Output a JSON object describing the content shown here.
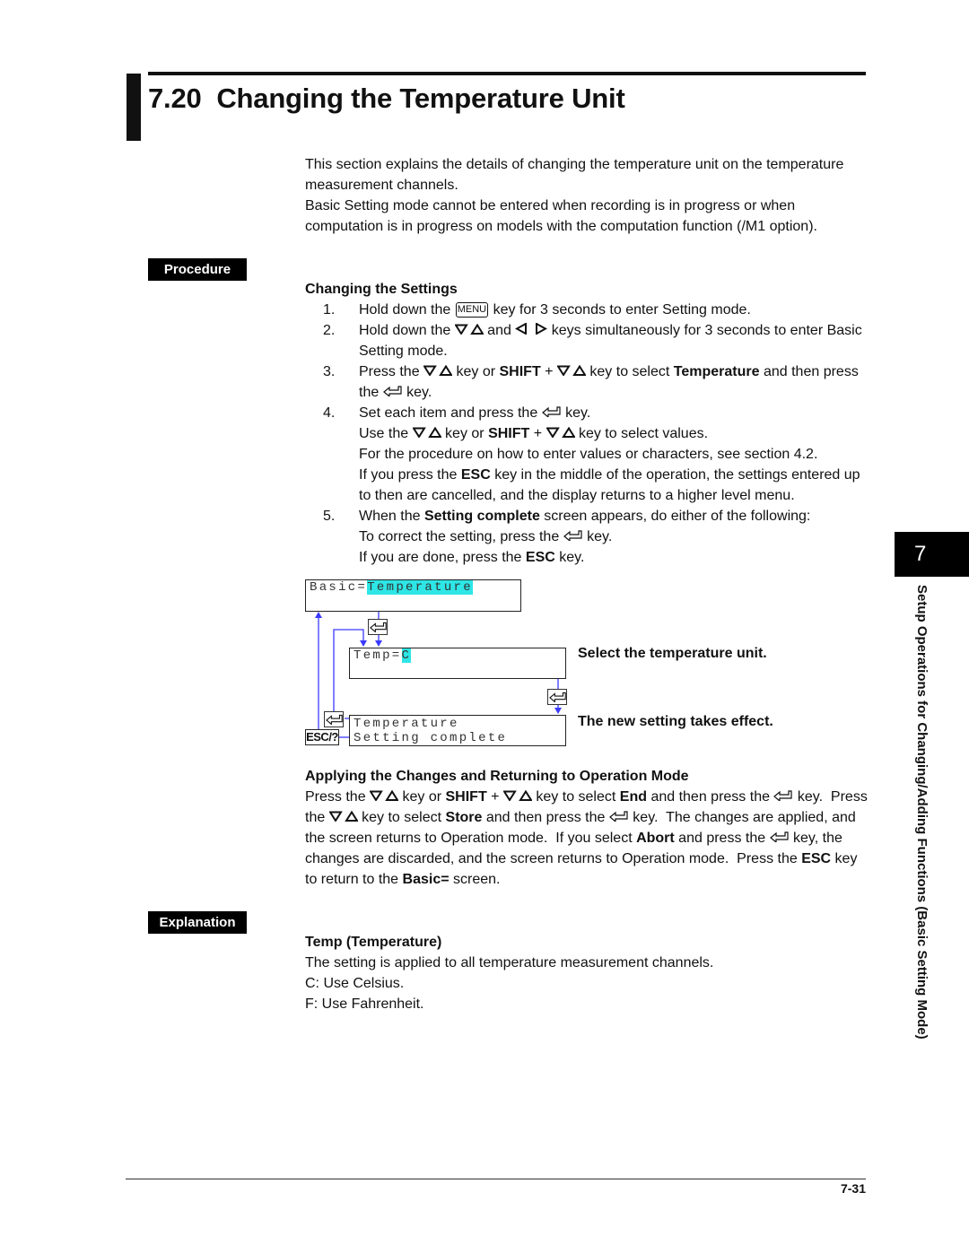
{
  "header": {
    "title": "7.20  Changing the Temperature Unit"
  },
  "intro": [
    [
      "This section explains the details of changing the temperature unit on the temperature"
    ],
    [
      "measurement channels."
    ],
    [
      "Basic Setting mode cannot be entered when recording is in progress or when"
    ],
    [
      "computation is in progress on models with the computation function (/M1 option)."
    ]
  ],
  "procedure": {
    "badge": "Procedure",
    "heading": "Changing the Settings",
    "numbers": [
      "1.",
      "2.",
      "3.",
      "4.",
      "5."
    ],
    "lines": [
      [
        "Hold down the ",
        {
          "key": "MENU"
        },
        " key for 3 seconds to enter Setting mode."
      ],
      [
        "Hold down the ",
        {
          "i": "updown"
        },
        " and ",
        {
          "i": "leftright"
        },
        " keys simultaneously for 3 seconds to enter Basic"
      ],
      [
        "Setting mode."
      ],
      [
        "Press the ",
        {
          "i": "updown"
        },
        " key or ",
        {
          "b": "SHIFT"
        },
        " + ",
        {
          "i": "updown"
        },
        " key to select ",
        {
          "b": "Temperature"
        },
        " and then press"
      ],
      [
        "the ",
        {
          "i": "enter"
        },
        " key."
      ],
      [
        "Set each item and press the ",
        {
          "i": "enter"
        },
        " key."
      ],
      [
        "Use the ",
        {
          "i": "updown"
        },
        " key or ",
        {
          "b": "SHIFT"
        },
        " + ",
        {
          "i": "updown"
        },
        " key to select values."
      ],
      [
        "For the procedure on how to enter values or characters, see section 4.2."
      ],
      [
        "If you press the ",
        {
          "b": "ESC"
        },
        " key in the middle of the operation, the settings entered up"
      ],
      [
        "to then are cancelled, and the display returns to a higher level menu."
      ],
      [
        "When the ",
        {
          "b": "Setting complete"
        },
        " screen appears, do either of the following:"
      ],
      [
        "To correct the setting, press the ",
        {
          "i": "enter"
        },
        " key."
      ],
      [
        "If you are done, press the ",
        {
          "b": "ESC"
        },
        " key."
      ]
    ]
  },
  "diagram": {
    "screen1": {
      "label": "Basic=",
      "value": "Temperature"
    },
    "screen2": {
      "label": "Temp=",
      "value": "C"
    },
    "screen3": {
      "line1": "Temperature",
      "line2": "Setting complete"
    },
    "esc_key": "ESC/?",
    "note1": "Select the temperature unit.",
    "note2": "The new setting takes effect.",
    "highlight_color": "#2ee6e6",
    "arrow_color": "#3a3aff"
  },
  "applying": {
    "heading": "Applying the Changes and Returning to Operation Mode",
    "lines": [
      [
        "Press the ",
        {
          "i": "updown"
        },
        " key or ",
        {
          "b": "SHIFT"
        },
        " + ",
        {
          "i": "updown"
        },
        " key to select ",
        {
          "b": "End"
        },
        " and then press the ",
        {
          "i": "enter"
        },
        " key.  Press"
      ],
      [
        "the ",
        {
          "i": "updown"
        },
        " key to select ",
        {
          "b": "Store"
        },
        " and then press the ",
        {
          "i": "enter"
        },
        " key.  The changes are applied, and"
      ],
      [
        "the screen returns to Operation mode.  If you select ",
        {
          "b": "Abort"
        },
        " and press the ",
        {
          "i": "enter"
        },
        " key, the"
      ],
      [
        "changes are discarded, and the screen returns to Operation mode.  Press the ",
        {
          "b": "ESC"
        },
        " key"
      ],
      [
        "to return to the ",
        {
          "b": "Basic="
        },
        " screen."
      ]
    ]
  },
  "explanation": {
    "badge": "Explanation",
    "heading": "Temp (Temperature)",
    "lines": [
      [
        "The setting is applied to all temperature measurement channels."
      ],
      [
        "C: Use Celsius."
      ],
      [
        "F: Use Fahrenheit."
      ]
    ]
  },
  "side_tab": {
    "number": "7",
    "label": "Setup Operations for Changing/Adding Functions (Basic Setting Mode)"
  },
  "footer": {
    "page": "7-31"
  }
}
